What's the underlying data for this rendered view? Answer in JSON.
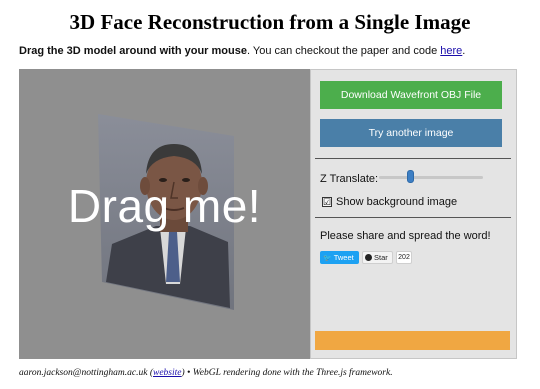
{
  "page": {
    "title": "3D Face Reconstruction from a Single Image",
    "intro_bold": "Drag the 3D model around with your mouse",
    "intro_text": ". You can checkout the paper and code ",
    "intro_link": "here",
    "intro_end": "."
  },
  "viewport": {
    "overlay_text": "Drag me!"
  },
  "panel": {
    "download_label": "Download Wavefront OBJ File",
    "try_label": "Try another image",
    "z_translate_label": "Z Translate:",
    "show_bg_label": "Show background image",
    "show_bg_checked": true,
    "share_text": "Please share and spread the word!",
    "tweet_label": "Tweet",
    "star_label": "Star",
    "star_count": "202",
    "checkbox_mark": "☑"
  },
  "footer": {
    "email": "aaron.jackson@nottingham.ac.uk",
    "open_paren": " (",
    "website_link": "website",
    "close_text": ") • WebGL rendering done with the Three.js framework."
  },
  "colors": {
    "download_button": "#4cae4c",
    "try_button": "#4a7fa8",
    "viewport_bg": "#8f8f8f",
    "panel_bg": "#e4e4e4",
    "bottom_bar": "#f0a742"
  }
}
